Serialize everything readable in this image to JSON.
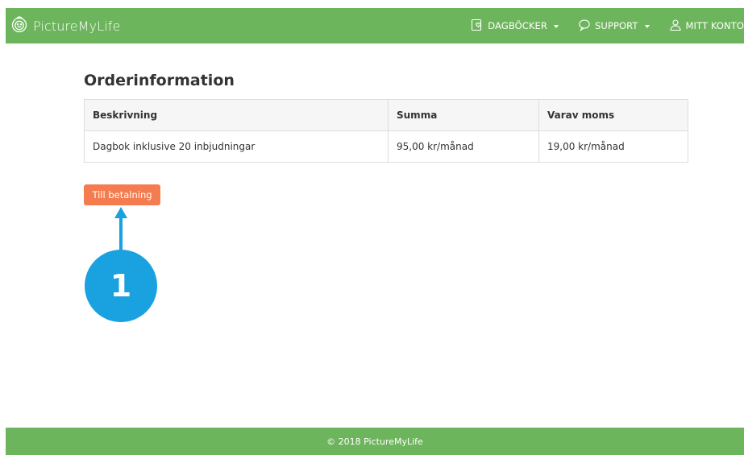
{
  "header": {
    "brand": "PictureMyLife",
    "nav": [
      {
        "label": "DAGBÖCKER",
        "icon": "diary-heart-icon"
      },
      {
        "label": "SUPPORT",
        "icon": "speech-bubble-icon"
      },
      {
        "label": "MITT KONTO",
        "icon": "user-icon"
      }
    ]
  },
  "main": {
    "title": "Orderinformation",
    "table": {
      "headers": [
        "Beskrivning",
        "Summa",
        "Varav moms"
      ],
      "rows": [
        [
          "Dagbok inklusive 20 inbjudningar",
          "95,00 kr/månad",
          "19,00 kr/månad"
        ]
      ]
    },
    "pay_button": "Till betalning"
  },
  "annotation": {
    "step": "1",
    "color": "#1aa1e0"
  },
  "footer": {
    "copyright": "© 2018 PictureMyLife"
  },
  "colors": {
    "brand_green": "#6db55c",
    "button_orange": "#f47c4f",
    "callout_blue": "#1aa1e0"
  }
}
